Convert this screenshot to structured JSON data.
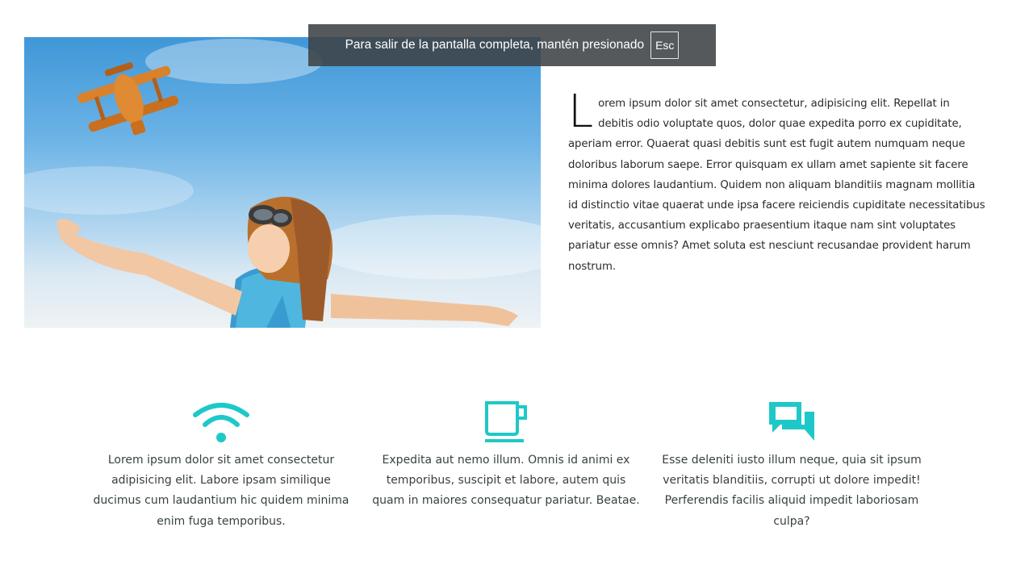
{
  "fullscreen_banner": {
    "message": "Para salir de la pantalla completa, mantén presionado",
    "key": "Esc"
  },
  "hero": {
    "image_icon": "child-aviator-with-toy-plane-photo"
  },
  "article": {
    "dropcap": "L",
    "text": "orem ipsum dolor sit amet consectetur, adipisicing elit. Repellat in debitis odio voluptate quos, dolor quae expedita porro ex cupiditate, aperiam error. Quaerat quasi debitis sunt est fugit autem numquam neque doloribus laborum saepe. Error quisquam ex ullam amet sapiente sit facere minima dolores laudantium. Quidem non aliquam blanditiis magnam mollitia id distinctio vitae quaerat unde ipsa facere reiciendis cupiditate necessitatibus veritatis, accusantium explicabo praesentium itaque nam sint voluptates pariatur esse omnis? Amet soluta est nesciunt recusandae provident harum nostrum."
  },
  "features": [
    {
      "icon": "wifi-icon",
      "text": "Lorem ipsum dolor sit amet consectetur adipisicing elit. Labore ipsam similique ducimus cum laudantium hic quidem minima enim fuga temporibus."
    },
    {
      "icon": "coffee-cup-icon",
      "text": "Expedita aut nemo illum. Omnis id animi ex temporibus, suscipit et labore, autem quis quam in maiores consequatur pariatur. Beatae."
    },
    {
      "icon": "chat-bubbles-icon",
      "text": "Esse deleniti iusto illum neque, quia sit ipsum veritatis blanditiis, corrupti ut dolore impedit! Perferendis facilis aliquid impedit laboriosam culpa?"
    }
  ],
  "colors": {
    "accent": "#1fc8c8",
    "banner_bg": "#3e4246",
    "text": "#37423f"
  }
}
